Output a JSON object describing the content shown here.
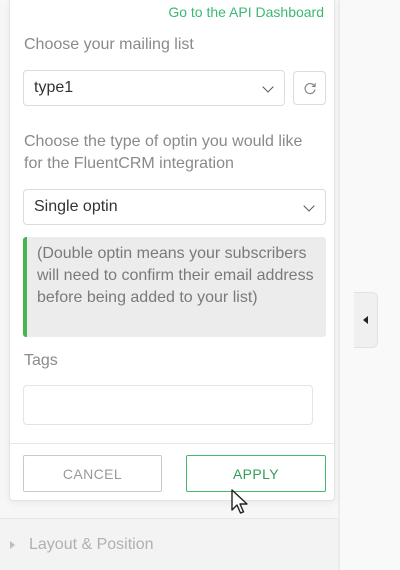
{
  "panel": {
    "api_link": "Go to the API Dashboard",
    "mailing_list": {
      "label": "Choose your mailing list",
      "selected": "type1",
      "refresh_icon": "refresh-icon"
    },
    "optin_type": {
      "label": "Choose the type of optin you would like for the FluentCRM integration",
      "selected": "Single optin"
    },
    "notice": "(Double optin means your subscribers will need to confirm their email address before being added to your list)",
    "tags": {
      "label": "Tags",
      "value": ""
    },
    "buttons": {
      "cancel": "CANCEL",
      "apply": "APPLY"
    }
  },
  "background": {
    "section_label": "Layout & Position",
    "collapse_icon": "caret-left-icon"
  },
  "colors": {
    "accent_green": "#46b450",
    "link_green": "#3bb873"
  }
}
